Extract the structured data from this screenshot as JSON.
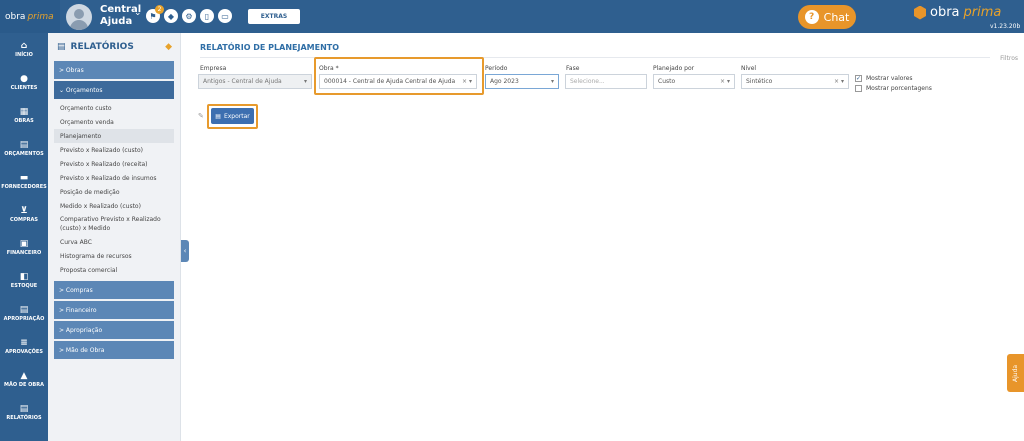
{
  "topbar": {
    "logo_text": "obra",
    "logo_italic": "prima",
    "user_name": "Central Ajuda",
    "notif_count": "2",
    "extras_label": "EXTRAS",
    "chat_label": "Chat",
    "brand_text": "obra",
    "brand_italic": "prima",
    "version": "v1.23.20b"
  },
  "leftnav": [
    {
      "label": "INÍCIO",
      "icon": "home-icon"
    },
    {
      "label": "CLIENTES",
      "icon": "user-icon"
    },
    {
      "label": "OBRAS",
      "icon": "building-icon"
    },
    {
      "label": "ORÇAMENTOS",
      "icon": "document-icon"
    },
    {
      "label": "FORNECEDORES",
      "icon": "truck-icon"
    },
    {
      "label": "COMPRAS",
      "icon": "cart-icon"
    },
    {
      "label": "FINANCEIRO",
      "icon": "calculator-icon"
    },
    {
      "label": "ESTOQUE",
      "icon": "boxes-icon"
    },
    {
      "label": "APROPRIAÇÃO",
      "icon": "file-icon"
    },
    {
      "label": "APROVAÇÕES",
      "icon": "approve-icon"
    },
    {
      "label": "MÃO DE OBRA",
      "icon": "workers-icon"
    },
    {
      "label": "RELATÓRIOS",
      "icon": "report-icon"
    }
  ],
  "menu": {
    "title": "RELATÓRIOS",
    "obras": "> Obras",
    "orcamentos": "⌄ Orçamentos",
    "items": [
      "Orçamento custo",
      "Orçamento venda",
      "Planejamento",
      "Previsto x Realizado (custo)",
      "Previsto x Realizado (receita)",
      "Previsto x Realizado de insumos",
      "Posição de medição",
      "Medido x Realizado (custo)",
      "Comparativo Previsto x Realizado (custo) x Medido",
      "Curva ABC",
      "Histograma de recursos",
      "Proposta comercial"
    ],
    "compras": "> Compras",
    "financeiro": "> Financeiro",
    "apropriacao": "> Apropriação",
    "mao_de_obra": "> Mão de Obra"
  },
  "main": {
    "title": "RELATÓRIO DE PLANEJAMENTO",
    "filtros": "Filtros",
    "export_label": "Exportar",
    "filters": {
      "empresa_label": "Empresa",
      "empresa_value": "Antigos - Central de Ajuda",
      "obra_label": "Obra *",
      "obra_value": "000014 - Central de Ajuda Central de Ajuda",
      "periodo_label": "Período",
      "periodo_value": "Ago 2023",
      "fase_label": "Fase",
      "fase_placeholder": "Selecione...",
      "planejado_label": "Planejado por",
      "planejado_value": "Custo",
      "nivel_label": "Nível",
      "nivel_value": "Sintético"
    },
    "checkboxes": {
      "mostrar_valores": "Mostrar valores",
      "mostrar_valores_checked": true,
      "mostrar_porcentagens": "Mostrar porcentagens",
      "mostrar_porcentagens_checked": false
    }
  },
  "ajuda_label": "Ajuda"
}
